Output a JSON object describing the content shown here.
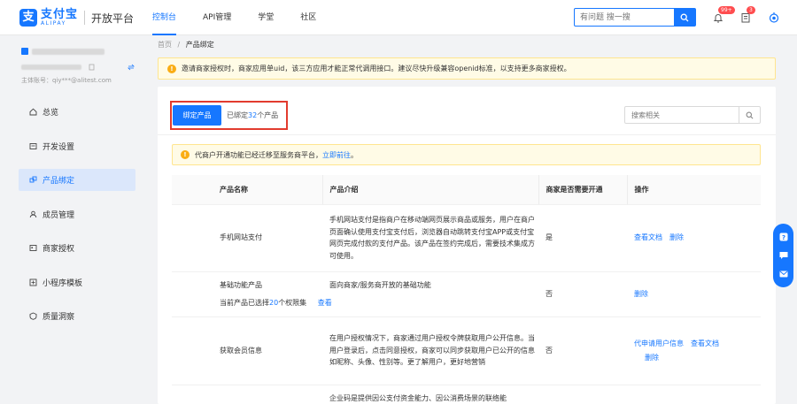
{
  "brand": {
    "mark": "支",
    "cn": "支付宝",
    "en": "ALIPAY",
    "platform": "开放平台"
  },
  "nav": [
    {
      "label": "控制台",
      "active": true
    },
    {
      "label": "API管理",
      "active": false
    },
    {
      "label": "学堂",
      "active": false
    },
    {
      "label": "社区",
      "active": false
    }
  ],
  "top_search": {
    "placeholder": "有问题 搜一搜"
  },
  "badges": {
    "messages": "99+",
    "tasks": "3"
  },
  "account": {
    "main_label": "主体账号：qiy***@alitest.com"
  },
  "sidebar": [
    {
      "label": "总览",
      "icon": "home-icon",
      "active": false
    },
    {
      "label": "开发设置",
      "icon": "dev-settings-icon",
      "active": false
    },
    {
      "label": "产品绑定",
      "icon": "product-bind-icon",
      "active": true
    },
    {
      "label": "成员管理",
      "icon": "members-icon",
      "active": false
    },
    {
      "label": "商家授权",
      "icon": "merchant-auth-icon",
      "active": false
    },
    {
      "label": "小程序模板",
      "icon": "miniapp-template-icon",
      "active": false
    },
    {
      "label": "质量洞察",
      "icon": "quality-icon",
      "active": false
    }
  ],
  "breadcrumb": {
    "home": "首页",
    "sep": "/",
    "current": "产品绑定"
  },
  "notice": "邀请商家授权时，商家应用单uid，该三方应用才能正常代调用接口。建议尽快升级兼容openid标准，以支持更多商家授权。",
  "toolbar": {
    "bind_button": "绑定产品",
    "bound_prefix": "已绑定",
    "bound_count": "32",
    "bound_suffix": "个产品",
    "search_placeholder": "搜索相关"
  },
  "notice2": {
    "text": "代商户开通功能已经迁移至服务商平台，",
    "link": "立即前往",
    "tail": "。"
  },
  "table": {
    "headers": [
      "产品名称",
      "产品介绍",
      "商家是否需要开通",
      "操作"
    ],
    "rows": [
      {
        "name": "手机网站支付",
        "sub": "",
        "sub_num": "",
        "sub_tail": "",
        "sub_link": "",
        "desc": "手机网站支付是指商户在移动端网页展示商品或服务，用户在商户页面确认使用支付宝支付后，浏览器自动跳转支付宝APP或支付宝网页完成付款的支付产品。该产品在签约完成后，需要技术集成方可使用。",
        "need": "是",
        "actions": [
          "查看文档",
          "删除"
        ]
      },
      {
        "name": "基础功能产品",
        "sub": "当前产品已选择",
        "sub_num": "20",
        "sub_tail": "个权限集",
        "sub_link": "查看",
        "desc": "面向商家/服务商开放的基础功能",
        "need": "否",
        "actions": [
          "删除"
        ]
      },
      {
        "name": "获取会员信息",
        "sub": "",
        "sub_num": "",
        "sub_tail": "",
        "sub_link": "",
        "desc": "在用户授权情况下，商家通过用户授权令牌获取用户公开信息。当用户登录后，点击同意授权，商家可以同步获取用户已公开的信息如昵称、头像、性别等。更了解用户，更好地营销",
        "need": "否",
        "actions": [
          "代申请用户信息",
          "查看文档",
          "删除"
        ]
      },
      {
        "name": "",
        "sub": "",
        "sub_num": "",
        "sub_tail": "",
        "sub_link": "",
        "desc": "企业码是提供因公支付资金能力、因公消费场景的联络能",
        "need": "",
        "actions": []
      }
    ]
  },
  "colors": {
    "accent": "#1677ff",
    "warn": "#faad14",
    "highlight": "#e23b2e"
  }
}
